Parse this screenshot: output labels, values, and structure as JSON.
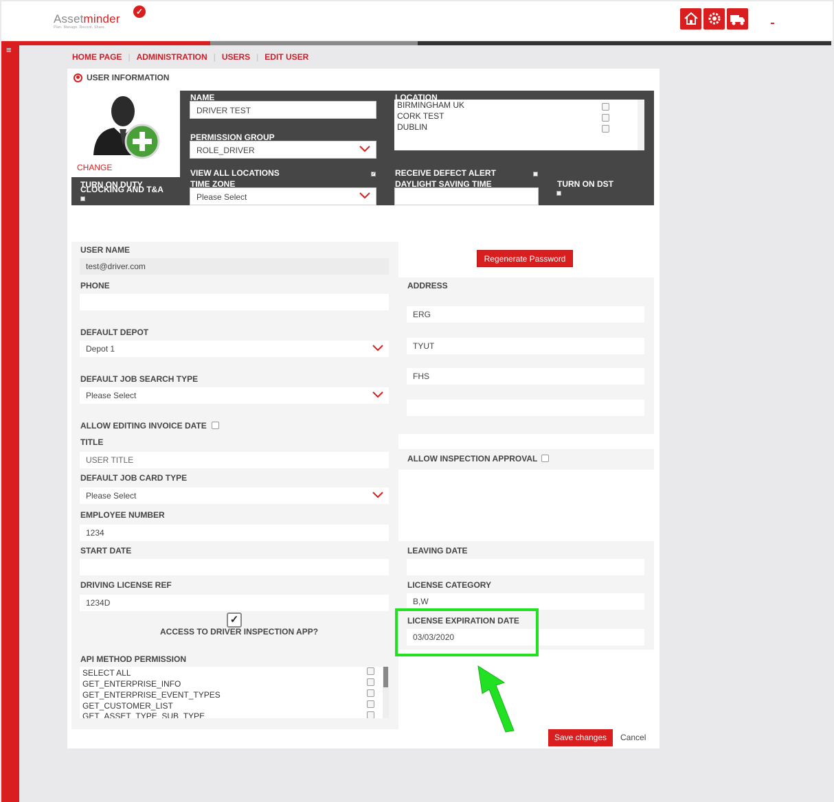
{
  "header": {
    "logo_text_a": "Asset",
    "logo_text_b": "minder",
    "logo_check": "✓",
    "tagline": "Plan. Manage. Record. Share.",
    "icons": [
      "home-icon",
      "gear-icon",
      "truck-icon"
    ]
  },
  "breadcrumb": [
    "HOME PAGE",
    "ADMINISTRATION",
    "USERS",
    "EDIT USER"
  ],
  "panel": {
    "title": "USER INFORMATION"
  },
  "dark": {
    "change": "CHANGE",
    "name_label": "NAME",
    "name_value": "DRIVER TEST",
    "permission_label": "PERMISSION GROUP",
    "permission_value": "ROLE_DRIVER",
    "location_label": "LOCATION",
    "locations": [
      "BIRMINGHAM UK",
      "CORK TEST",
      "DUBLIN"
    ],
    "view_all_label": "VIEW ALL LOCATIONS",
    "view_all_checked": true,
    "defect_alert_label": "RECEIVE DEFECT ALERT",
    "duty_label": "TURN ON DUTY",
    "clocking_label": "CLOCKING AND T&A",
    "timezone_label": "TIME ZONE",
    "timezone_value": "Please Select",
    "dst_time_label": "DAYLIGHT SAVING TIME",
    "dst_label": "TURN ON DST"
  },
  "form": {
    "username_label": "USER NAME",
    "username_value": "test@driver.com",
    "regen_button": "Regenerate Password",
    "phone_label": "PHONE",
    "address_label": "ADDRESS",
    "address_lines": [
      "ERG",
      "TYUT",
      "FHS",
      ""
    ],
    "depot_label": "DEFAULT DEPOT",
    "depot_value": "Depot 1",
    "job_search_label": "DEFAULT JOB SEARCH TYPE",
    "job_search_value": "Please Select",
    "invoice_label": "ALLOW EDITING INVOICE DATE",
    "title_label": "TITLE",
    "title_placeholder": "USER TITLE",
    "inspection_approval_label": "ALLOW INSPECTION APPROVAL",
    "job_card_label": "DEFAULT JOB CARD TYPE",
    "job_card_value": "Please Select",
    "employee_label": "EMPLOYEE NUMBER",
    "employee_value": "1234",
    "start_label": "START DATE",
    "leaving_label": "LEAVING DATE",
    "license_ref_label": "DRIVING LICENSE REF",
    "license_ref_value": "1234D",
    "license_cat_label": "LICENSE CATEGORY",
    "license_cat_value": "B,W",
    "access_label": "ACCESS TO DRIVER INSPECTION APP?",
    "access_checked": true,
    "license_exp_label": "LICENSE EXPIRATION DATE",
    "license_exp_value": "03/03/2020",
    "api_label": "API METHOD PERMISSION",
    "api_items": [
      "SELECT ALL",
      "GET_ENTERPRISE_INFO",
      "GET_ENTERPRISE_EVENT_TYPES",
      "GET_CUSTOMER_LIST",
      "GET_ASSET_TYPE_SUB_TYPE"
    ],
    "save_button": "Save changes",
    "cancel": "Cancel"
  },
  "colors": {
    "brand": "#d81e1e",
    "dark": "#464646",
    "highlight": "#22e022"
  }
}
